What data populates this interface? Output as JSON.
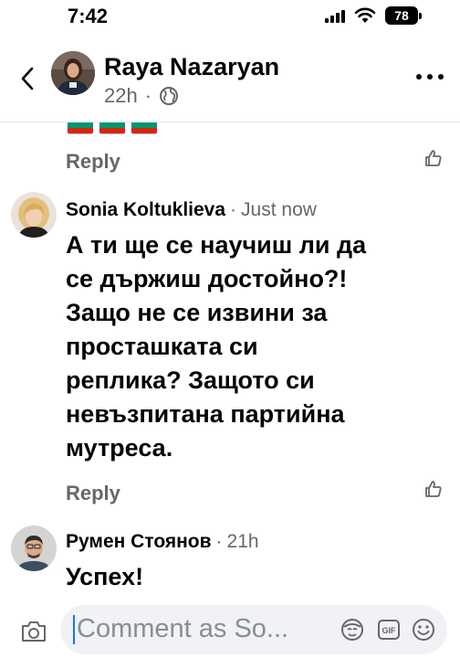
{
  "status_bar": {
    "time": "7:42",
    "battery": "78"
  },
  "header": {
    "name": "Raya Nazaryan",
    "age": "22h",
    "dot": "·"
  },
  "flags": [
    "bulgarian-flag",
    "bulgarian-flag",
    "bulgarian-flag"
  ],
  "previous_comment": {
    "reply_label": "Reply"
  },
  "comments": [
    {
      "author": "Sonia Koltuklieva",
      "separator": "·",
      "time": "Just now",
      "lines": [
        "А ти ще се научиш ли да",
        "се държиш достойно?!",
        "Защо не се извини за",
        "просташката си",
        "реплика? Защото си",
        "невъзпитана партийна",
        "мутреса."
      ],
      "reply_label": "Reply"
    },
    {
      "author": "Румен Стоянов",
      "separator": "·",
      "time": "21h",
      "lines": [
        "Успех!"
      ]
    }
  ],
  "composer": {
    "placeholder": "Comment as So...",
    "gif_label": "GIF"
  },
  "colors": {
    "accent": "#1877f2",
    "muted": "#65676b",
    "input_bg": "#f0f2f5"
  }
}
